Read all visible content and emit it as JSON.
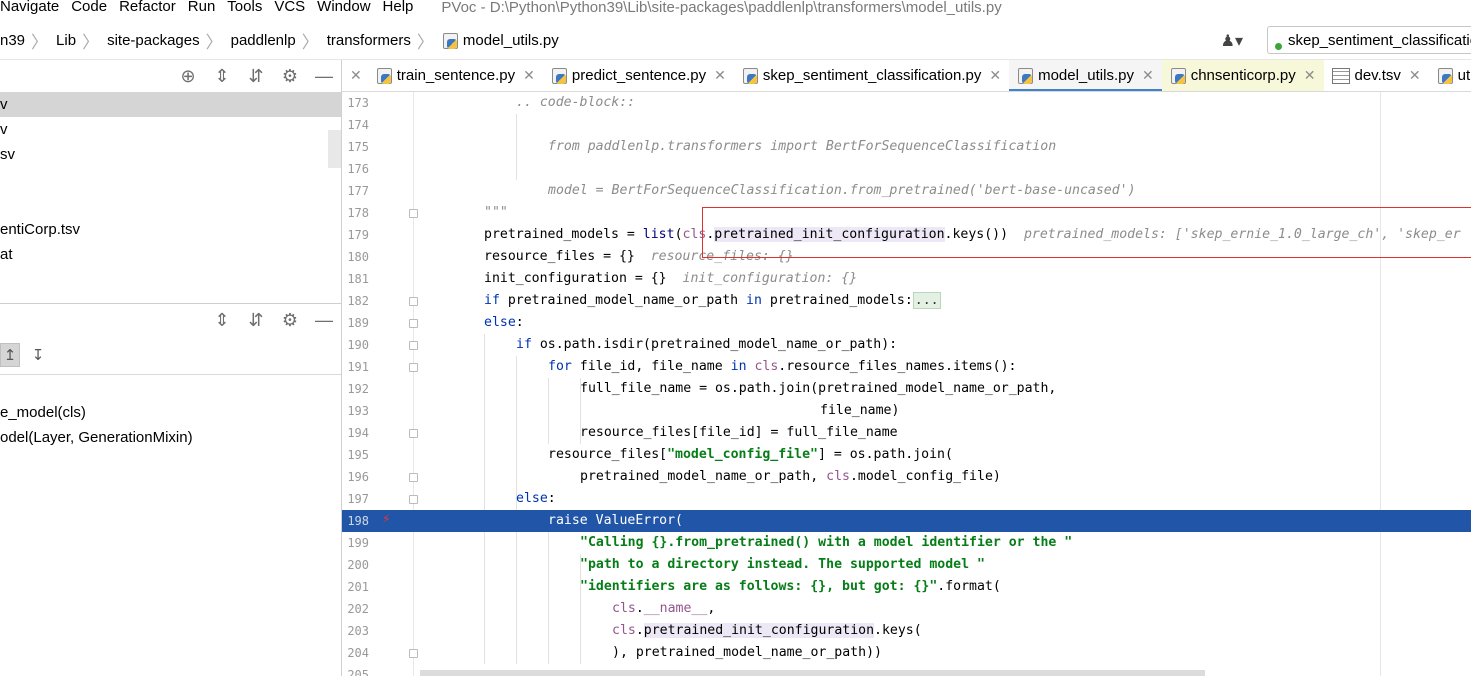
{
  "menu": {
    "items": [
      "Navigate",
      "Code",
      "Refactor",
      "Run",
      "Tools",
      "VCS",
      "Window",
      "Help"
    ],
    "window_title": "PVoc - D:\\Python\\Python39\\Lib\\site-packages\\paddlenlp\\transformers\\model_utils.py"
  },
  "breadcrumb": {
    "items": [
      "n39",
      "Lib",
      "site-packages",
      "paddlenlp",
      "transformers",
      "model_utils.py"
    ]
  },
  "toolbar": {
    "user_icon": "user-dropdown-icon",
    "run_config_label": "skep_sentiment_classification"
  },
  "project_panel": {
    "tools": [
      "locate-icon",
      "expand-all-icon",
      "collapse-all-icon",
      "gear-icon",
      "minimize-icon"
    ],
    "rows": [
      "v",
      "v",
      "sv",
      "",
      "entiCorp.tsv",
      "at"
    ]
  },
  "structure_panel": {
    "tools": [
      "expand-all-icon",
      "collapse-all-icon",
      "gear-icon",
      "minimize-icon"
    ],
    "rows": [
      "e_model(cls)",
      "odel(Layer, GenerationMixin)"
    ]
  },
  "tabs": [
    {
      "label": "train_sentence.py",
      "icon": "python-file-icon",
      "active": false
    },
    {
      "label": "predict_sentence.py",
      "icon": "python-file-icon",
      "active": false
    },
    {
      "label": "skep_sentiment_classification.py",
      "icon": "python-file-icon",
      "active": false
    },
    {
      "label": "model_utils.py",
      "icon": "python-file-icon",
      "active": true
    },
    {
      "label": "chnsenticorp.py",
      "icon": "python-file-icon",
      "active": false
    },
    {
      "label": "dev.tsv",
      "icon": "tsv-file-icon",
      "active": false
    },
    {
      "label": "uti",
      "icon": "python-file-icon",
      "active": false
    }
  ],
  "editor": {
    "line_numbers": [
      "173",
      "174",
      "175",
      "176",
      "177",
      "178",
      "179",
      "180",
      "181",
      "182",
      "189",
      "190",
      "191",
      "192",
      "193",
      "194",
      "195",
      "196",
      "197",
      "198",
      "199",
      "200",
      "201",
      "202",
      "203",
      "204",
      "205"
    ],
    "highlighted_line": "198",
    "inline_hints": {
      "pretrained_models": "pretrained_models: ['skep_ernie_1.0_large_ch', 'skep_er",
      "resource_files": "resource_files: {}",
      "init_configuration": "init_configuration: {}"
    }
  }
}
